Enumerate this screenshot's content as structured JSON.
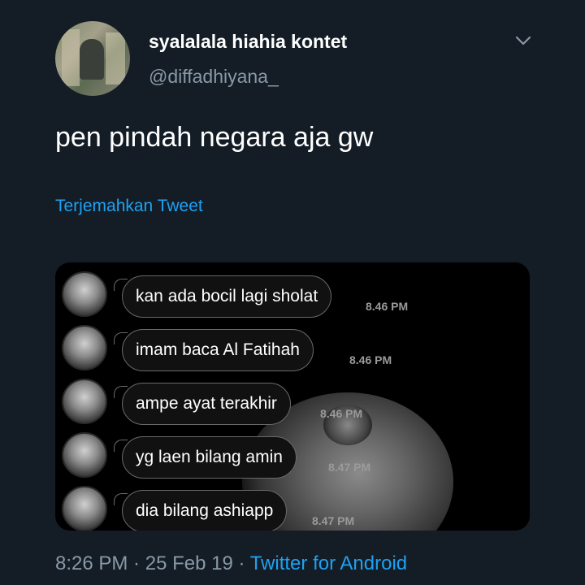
{
  "tweet": {
    "display_name": "syalalala hiahia kontet",
    "handle": "@diffadhiyana_",
    "text": "pen pindah negara aja gw",
    "translate_label": "Terjemahkan Tweet",
    "time": "8:26 PM",
    "separator1": " · ",
    "date": "25 Feb 19",
    "separator2": " · ",
    "source": "Twitter for Android",
    "menu_icon": "chevron-down-icon"
  },
  "media": {
    "messages": [
      {
        "text": "kan ada bocil lagi sholat",
        "time": "8.46 PM"
      },
      {
        "text": "imam baca Al Fatihah",
        "time": "8.46 PM"
      },
      {
        "text": "ampe ayat terakhir",
        "time": "8.46 PM"
      },
      {
        "text": "yg laen bilang amin",
        "time": "8.47 PM"
      },
      {
        "text": "dia bilang ashiapp",
        "time": "8.47 PM"
      }
    ]
  },
  "colors": {
    "background": "#141d26",
    "link": "#1da1f2",
    "muted": "#8899a6"
  }
}
